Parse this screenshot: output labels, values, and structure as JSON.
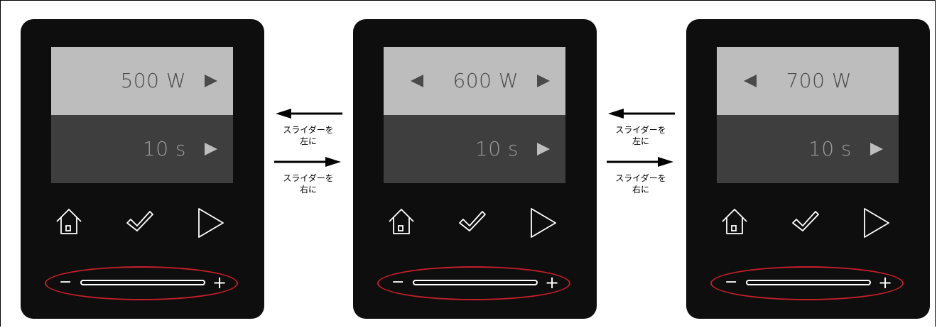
{
  "panels": [
    {
      "power": "500 W",
      "time": "10 s",
      "has_left_arrow": false,
      "has_right_arrow": true
    },
    {
      "power": "600 W",
      "time": "10 s",
      "has_left_arrow": true,
      "has_right_arrow": true
    },
    {
      "power": "700 W",
      "time": "10 s",
      "has_left_arrow": true,
      "has_right_arrow": false
    }
  ],
  "captions": {
    "slide_left": [
      "スライダーを",
      "左に"
    ],
    "slide_right": [
      "スライダーを",
      "右に"
    ]
  },
  "slider": {
    "minus": "−",
    "plus": "+"
  },
  "colors": {
    "device_bg": "#0e0e0e",
    "power_row_bg": "#bdbdbd",
    "time_row_bg": "#3e3e3e",
    "slider_highlight": "#c51f2a"
  },
  "icons": [
    "home-icon",
    "check-icon",
    "play-icon",
    "left-triangle-icon",
    "right-triangle-icon"
  ]
}
